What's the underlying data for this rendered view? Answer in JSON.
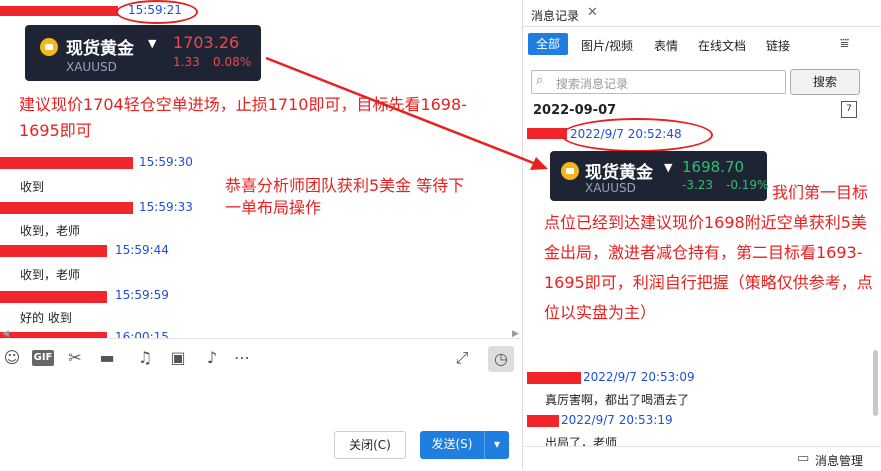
{
  "chat": {
    "top_time": "15:59:21",
    "card1": {
      "name": "现货黄金",
      "price": "1703.26",
      "change": "1.33",
      "pct": "0.08%",
      "symbol": "XAUUSD"
    },
    "advice": "建议现价1704轻仓空单进场，止损1710即可，目标先看1698-1695即可",
    "congrats": "恭喜分析师团队获利5美金 等待下一单布局操作",
    "messages": [
      {
        "time": "15:59:30",
        "text": "收到"
      },
      {
        "time": "15:59:33",
        "text": "收到，老师"
      },
      {
        "time": "15:59:44",
        "text": "收到，老师"
      },
      {
        "time": "15:59:59",
        "text": "好的 收到"
      },
      {
        "time": "16:00:15",
        "text": ""
      }
    ],
    "close_label": "关闭(C)",
    "send_label": "发送(S)"
  },
  "history": {
    "title": "消息记录",
    "tabs": [
      "全部",
      "图片/视频",
      "表情",
      "在线文档",
      "链接"
    ],
    "search_placeholder": "搜索消息记录",
    "search_button": "搜索",
    "date": "2022-09-07",
    "t1": "2022/9/7 20:52:48",
    "card2": {
      "name": "现货黄金",
      "price": "1698.70",
      "change": "-3.23",
      "pct": "-0.19%",
      "symbol": "XAUUSD"
    },
    "message": "我们第一目标点位已经到达建议现价1698附近空单获利5美金出局，激进者减仓持有，第二目标看1693-1695即可，利润自行把握（策略仅供参考，点位以实盘为主）",
    "t2": "2022/9/7 20:53:09",
    "m2": "真厉害啊，都出了喝酒去了",
    "t3": "2022/9/7 20:53:19",
    "m3": "出局了，老师",
    "manage": "消息管理"
  },
  "colors": {
    "accent": "#1f7ee0",
    "red": "#e8201f",
    "card_bg": "#1e2433",
    "pos": "#2fbf71",
    "neg": "#f04848"
  }
}
